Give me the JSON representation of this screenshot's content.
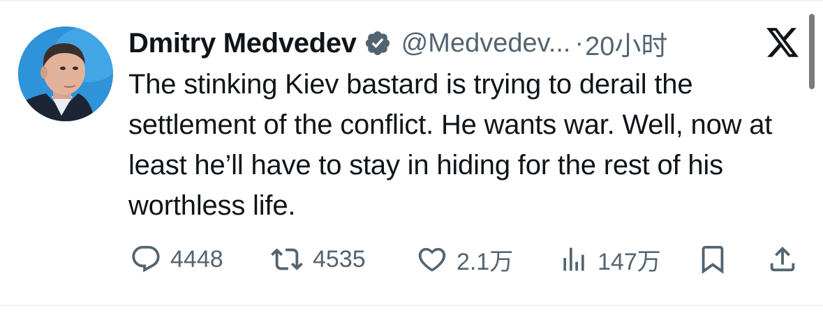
{
  "post": {
    "author": {
      "display_name": "Dmitry Medvedev",
      "handle": "@Medvedev...",
      "verified": true
    },
    "separator": "·",
    "time": "20小时",
    "text": "The stinking Kiev bastard is trying to derail the settlement of the conflict. He wants war. Well, now at least he’ll have to stay in hiding for the rest of his worthless life."
  },
  "actions": {
    "replies": "4448",
    "reposts": "4535",
    "likes": "2.1万",
    "views": "147万"
  },
  "icons": {
    "verified": "verified-badge-icon",
    "platform": "x-logo-icon",
    "reply": "reply-icon",
    "repost": "repost-icon",
    "like": "heart-icon",
    "views": "views-icon",
    "bookmark": "bookmark-icon",
    "share": "share-icon"
  },
  "colors": {
    "text": "#0f1419",
    "secondary": "#536471",
    "divider": "#eff3f4",
    "avatar_bg": "#2e93d9"
  }
}
